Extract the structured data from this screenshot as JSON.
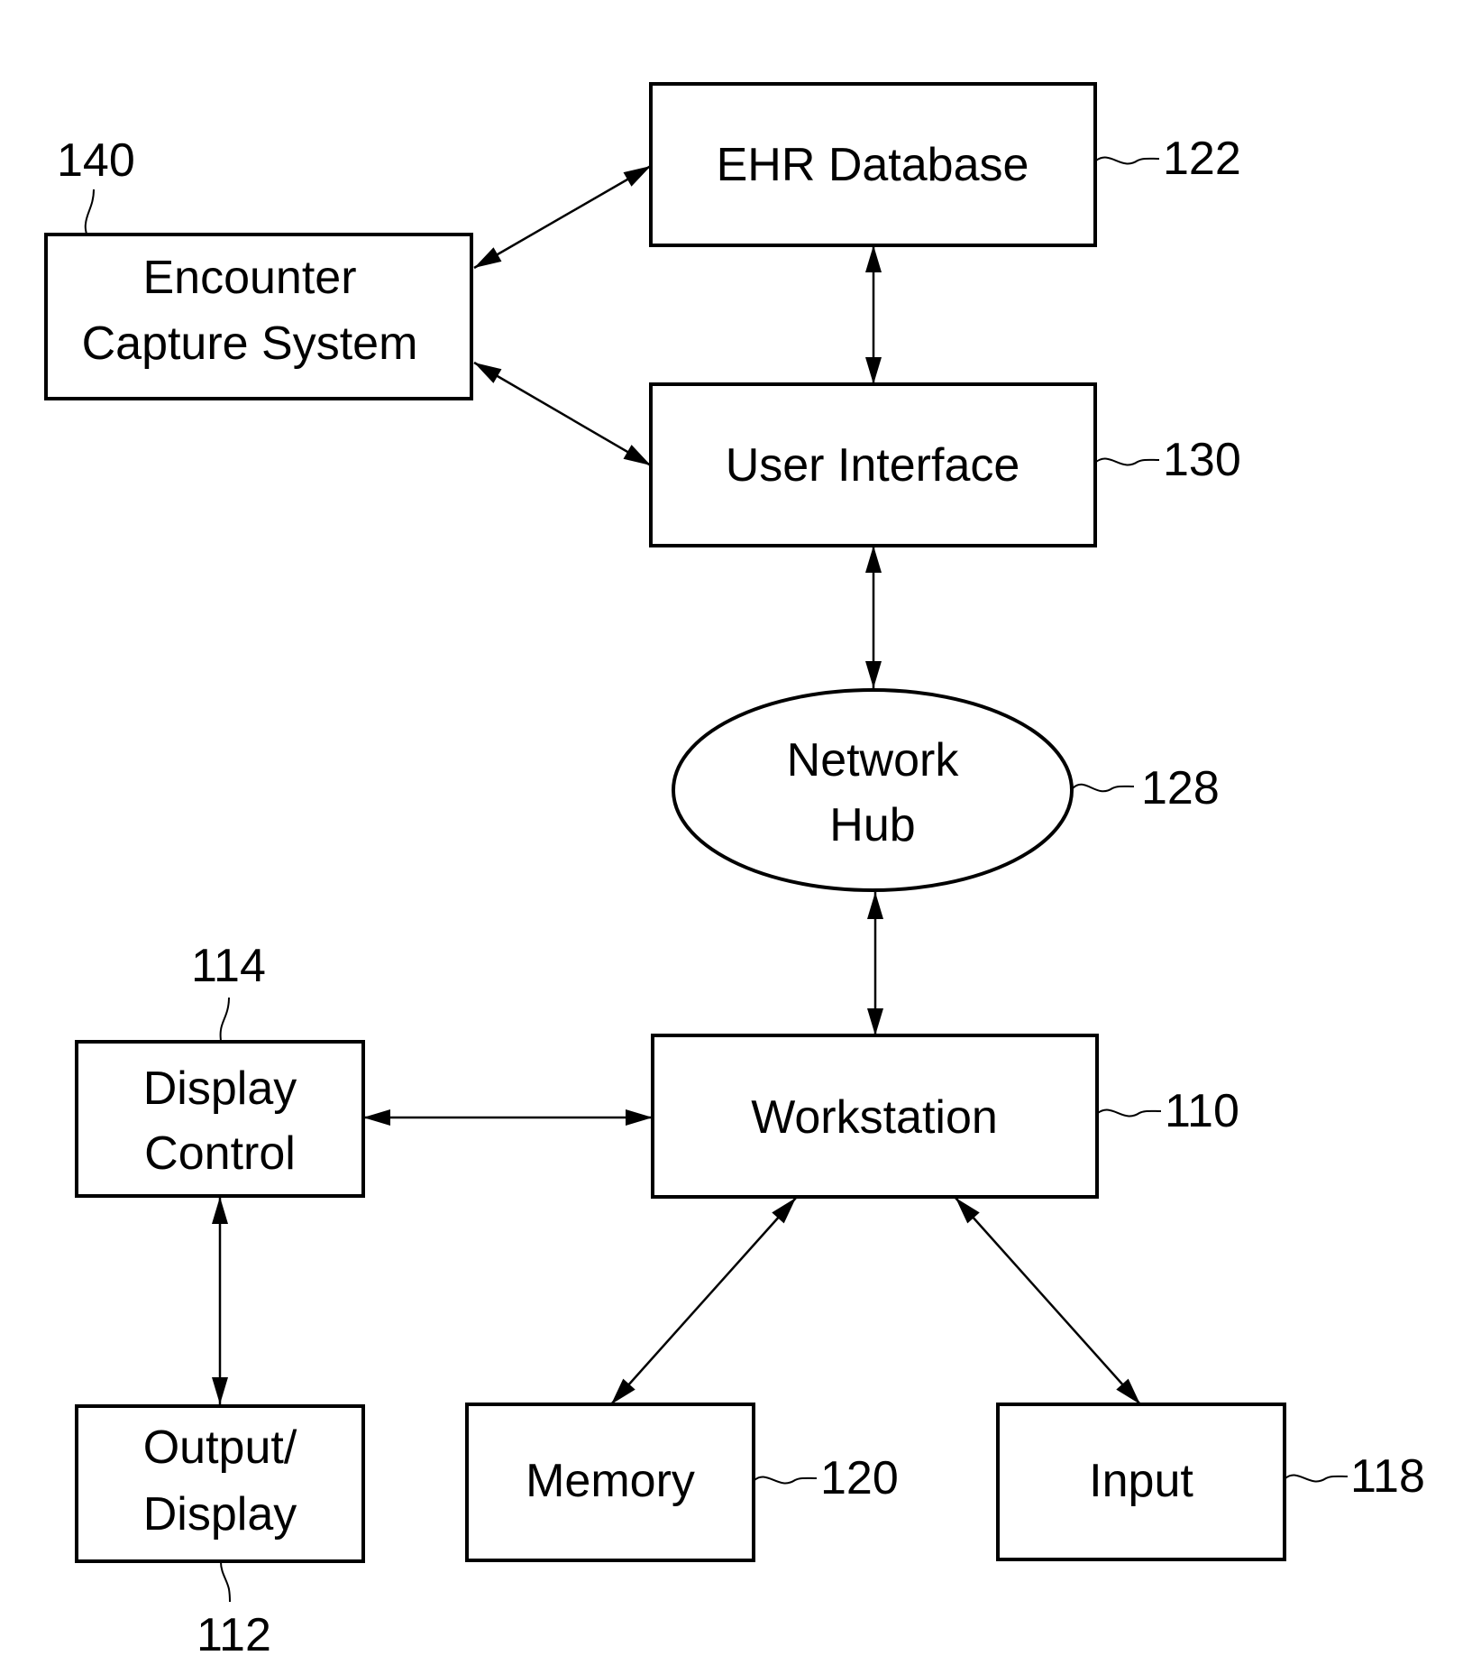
{
  "figure": {
    "type": "block-diagram",
    "stroke_color": "#000000",
    "background_color": "#ffffff"
  },
  "nodes": {
    "ehr_database": {
      "label_lines": [
        "EHR Database"
      ],
      "ref": "122",
      "shape": "rectangle"
    },
    "user_interface": {
      "label_lines": [
        "User Interface"
      ],
      "ref": "130",
      "shape": "rectangle"
    },
    "encounter_capture": {
      "label_lines": [
        "Encounter",
        "Capture System"
      ],
      "ref": "140",
      "shape": "rectangle"
    },
    "network_hub": {
      "label_lines": [
        "Network",
        "Hub"
      ],
      "ref": "128",
      "shape": "ellipse"
    },
    "workstation": {
      "label_lines": [
        "Workstation"
      ],
      "ref": "110",
      "shape": "rectangle"
    },
    "display_control": {
      "label_lines": [
        "Display",
        "Control"
      ],
      "ref": "114",
      "shape": "rectangle"
    },
    "output_display": {
      "label_lines": [
        "Output/",
        "Display"
      ],
      "ref": "112",
      "shape": "rectangle"
    },
    "memory": {
      "label_lines": [
        "Memory"
      ],
      "ref": "120",
      "shape": "rectangle"
    },
    "input": {
      "label_lines": [
        "Input"
      ],
      "ref": "118",
      "shape": "rectangle"
    }
  },
  "edges": [
    {
      "from": "encounter_capture",
      "to": "ehr_database",
      "direction": "bidirectional"
    },
    {
      "from": "encounter_capture",
      "to": "user_interface",
      "direction": "bidirectional"
    },
    {
      "from": "ehr_database",
      "to": "user_interface",
      "direction": "bidirectional"
    },
    {
      "from": "user_interface",
      "to": "network_hub",
      "direction": "bidirectional"
    },
    {
      "from": "network_hub",
      "to": "workstation",
      "direction": "bidirectional"
    },
    {
      "from": "display_control",
      "to": "workstation",
      "direction": "bidirectional"
    },
    {
      "from": "display_control",
      "to": "output_display",
      "direction": "bidirectional"
    },
    {
      "from": "workstation",
      "to": "memory",
      "direction": "bidirectional"
    },
    {
      "from": "workstation",
      "to": "input",
      "direction": "bidirectional"
    }
  ]
}
